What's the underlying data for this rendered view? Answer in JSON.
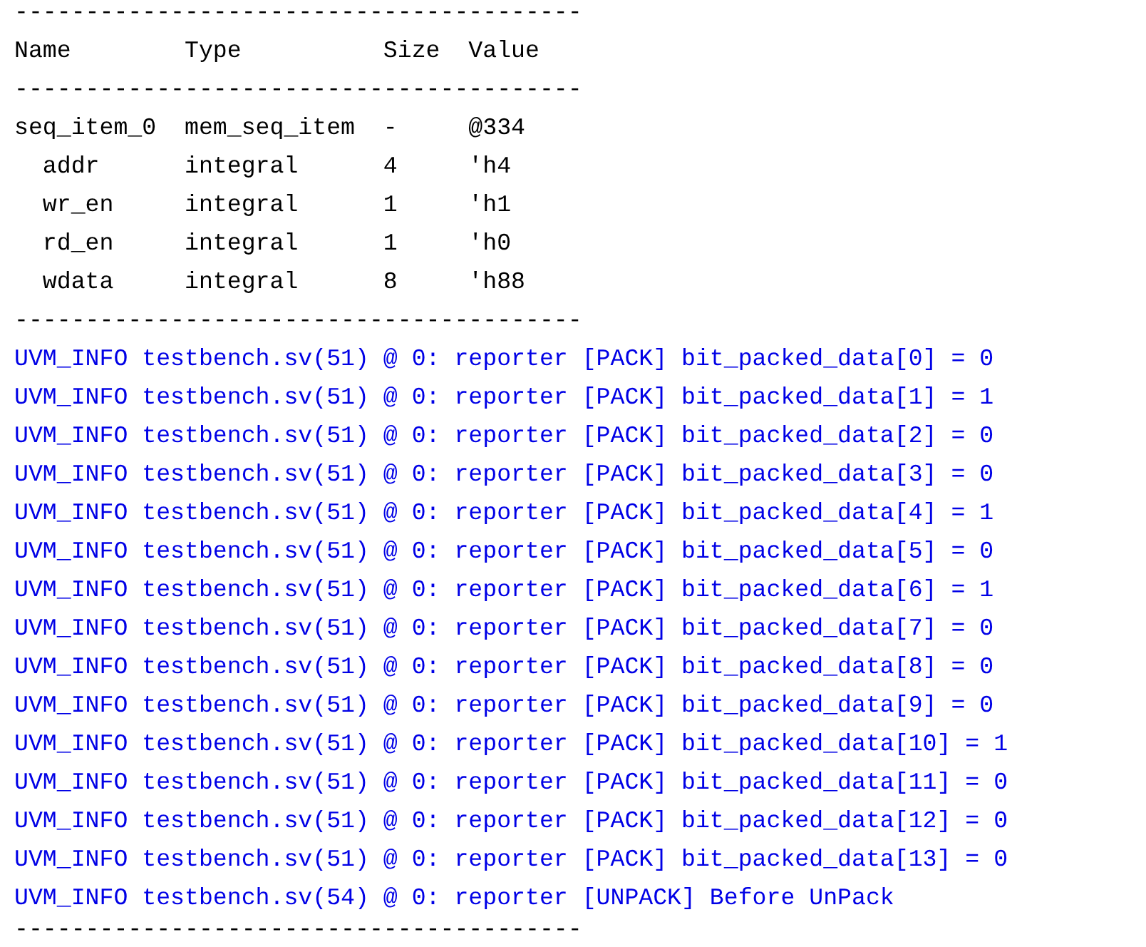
{
  "lines": [
    {
      "kind": "rule",
      "text": "----------------------------------------"
    },
    {
      "kind": "header",
      "text": "Name        Type          Size  Value"
    },
    {
      "kind": "rule",
      "text": "----------------------------------------"
    },
    {
      "kind": "row",
      "text": "seq_item_0  mem_seq_item  -     @334"
    },
    {
      "kind": "row",
      "text": "  addr      integral      4     'h4"
    },
    {
      "kind": "row",
      "text": "  wr_en     integral      1     'h1"
    },
    {
      "kind": "row",
      "text": "  rd_en     integral      1     'h0"
    },
    {
      "kind": "row",
      "text": "  wdata     integral      8     'h88"
    },
    {
      "kind": "rule",
      "text": "----------------------------------------"
    },
    {
      "kind": "log",
      "text": "UVM_INFO testbench.sv(51) @ 0: reporter [PACK] bit_packed_data[0] = 0"
    },
    {
      "kind": "log",
      "text": "UVM_INFO testbench.sv(51) @ 0: reporter [PACK] bit_packed_data[1] = 1"
    },
    {
      "kind": "log",
      "text": "UVM_INFO testbench.sv(51) @ 0: reporter [PACK] bit_packed_data[2] = 0"
    },
    {
      "kind": "log",
      "text": "UVM_INFO testbench.sv(51) @ 0: reporter [PACK] bit_packed_data[3] = 0"
    },
    {
      "kind": "log",
      "text": "UVM_INFO testbench.sv(51) @ 0: reporter [PACK] bit_packed_data[4] = 1"
    },
    {
      "kind": "log",
      "text": "UVM_INFO testbench.sv(51) @ 0: reporter [PACK] bit_packed_data[5] = 0"
    },
    {
      "kind": "log",
      "text": "UVM_INFO testbench.sv(51) @ 0: reporter [PACK] bit_packed_data[6] = 1"
    },
    {
      "kind": "log",
      "text": "UVM_INFO testbench.sv(51) @ 0: reporter [PACK] bit_packed_data[7] = 0"
    },
    {
      "kind": "log",
      "text": "UVM_INFO testbench.sv(51) @ 0: reporter [PACK] bit_packed_data[8] = 0"
    },
    {
      "kind": "log",
      "text": "UVM_INFO testbench.sv(51) @ 0: reporter [PACK] bit_packed_data[9] = 0"
    },
    {
      "kind": "log",
      "text": "UVM_INFO testbench.sv(51) @ 0: reporter [PACK] bit_packed_data[10] = 1"
    },
    {
      "kind": "log",
      "text": "UVM_INFO testbench.sv(51) @ 0: reporter [PACK] bit_packed_data[11] = 0"
    },
    {
      "kind": "log",
      "text": "UVM_INFO testbench.sv(51) @ 0: reporter [PACK] bit_packed_data[12] = 0"
    },
    {
      "kind": "log",
      "text": "UVM_INFO testbench.sv(51) @ 0: reporter [PACK] bit_packed_data[13] = 0"
    },
    {
      "kind": "log",
      "text": "UVM_INFO testbench.sv(54) @ 0: reporter [UNPACK] Before UnPack"
    },
    {
      "kind": "rule",
      "text": "----------------------------------------"
    }
  ]
}
